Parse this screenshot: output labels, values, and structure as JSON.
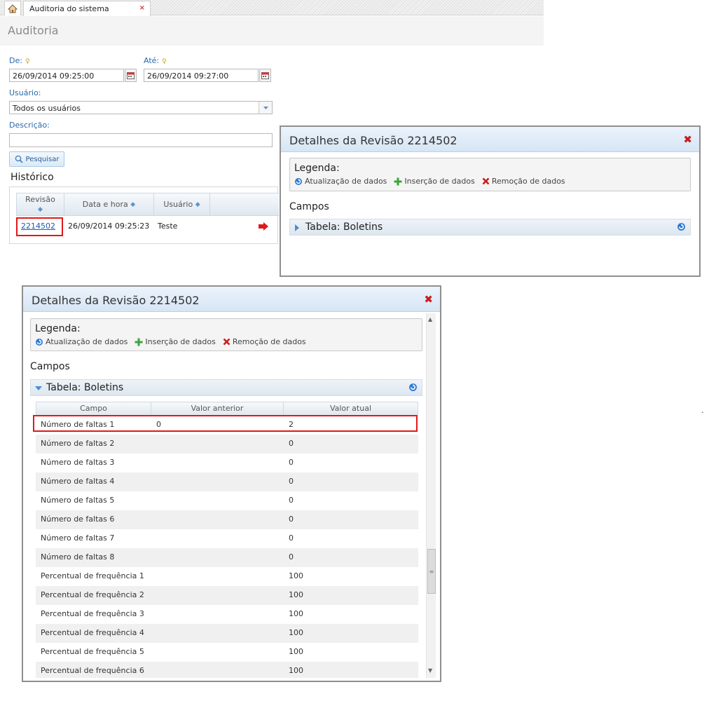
{
  "tabs": {
    "active": "Auditoria do sistema",
    "close": "×"
  },
  "page": {
    "title": "Auditoria"
  },
  "form": {
    "de_label": "De:",
    "ate_label": "Até:",
    "de_value": "26/09/2014 09:25:00",
    "ate_value": "26/09/2014 09:27:00",
    "usuario_label": "Usuário:",
    "usuario_value": "Todos os usuários",
    "descricao_label": "Descrição:",
    "descricao_value": "",
    "search_button": "Pesquisar"
  },
  "historico": {
    "title": "Histórico",
    "columns": [
      "Revisão",
      "Data e hora",
      "Usuário"
    ],
    "row": {
      "revisao": "2214502",
      "data": "26/09/2014 09:25:23",
      "usuario": "Teste"
    }
  },
  "dialog": {
    "title": "Detalhes da Revisão 2214502",
    "close": "✖",
    "legend_title": "Legenda:",
    "legend": [
      "Atualização de dados",
      "Inserção de dados",
      "Remoção de dados"
    ],
    "campos": "Campos",
    "tabela": "Tabela: Boletins"
  },
  "grid": {
    "columns": [
      "Campo",
      "Valor anterior",
      "Valor atual"
    ],
    "rows": [
      {
        "campo": "Número de faltas 1",
        "anterior": "0",
        "atual": "2"
      },
      {
        "campo": "Número de faltas 2",
        "anterior": "",
        "atual": "0"
      },
      {
        "campo": "Número de faltas 3",
        "anterior": "",
        "atual": "0"
      },
      {
        "campo": "Número de faltas 4",
        "anterior": "",
        "atual": "0"
      },
      {
        "campo": "Número de faltas 5",
        "anterior": "",
        "atual": "0"
      },
      {
        "campo": "Número de faltas 6",
        "anterior": "",
        "atual": "0"
      },
      {
        "campo": "Número de faltas 7",
        "anterior": "",
        "atual": "0"
      },
      {
        "campo": "Número de faltas 8",
        "anterior": "",
        "atual": "0"
      },
      {
        "campo": "Percentual de frequência 1",
        "anterior": "",
        "atual": "100"
      },
      {
        "campo": "Percentual de frequência 2",
        "anterior": "",
        "atual": "100"
      },
      {
        "campo": "Percentual de frequência 3",
        "anterior": "",
        "atual": "100"
      },
      {
        "campo": "Percentual de frequência 4",
        "anterior": "",
        "atual": "100"
      },
      {
        "campo": "Percentual de frequência 5",
        "anterior": "",
        "atual": "100"
      },
      {
        "campo": "Percentual de frequência 6",
        "anterior": "",
        "atual": "100"
      }
    ]
  },
  "colors": {
    "accent": "#2a6aa8",
    "highlight": "#e01919",
    "header": "#d6e5f5"
  },
  "stray_mark": "."
}
